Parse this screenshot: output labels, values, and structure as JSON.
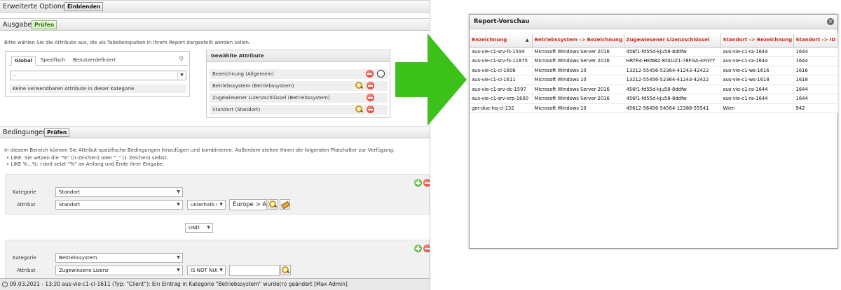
{
  "left": {
    "advanced": {
      "title": "Erweiterte Optionen",
      "toggle_label": "Einblenden"
    },
    "output": {
      "title": "Ausgabe",
      "check_label": "Prüfen",
      "description": "Bitte wählen Sie die Attribute aus, die als Tabellenspalten in Ihrem Report dargestellt werden sollen.",
      "tabs": [
        {
          "label": "Global"
        },
        {
          "label": "Spezifisch"
        },
        {
          "label": "Benutzerdefiniert"
        }
      ],
      "category_select_value": "-",
      "no_attributes_text": "Keine verwendbaren Attribute in dieser Kategorie",
      "selected_header": "Gewählte Attribute",
      "selected": [
        {
          "label": "Bezeichnung (Allgemein)"
        },
        {
          "label": "Betriebssystem (Betriebssystem)"
        },
        {
          "label": "Zugewiesener Lizenzschlüssel (Betriebssystem)"
        },
        {
          "label": "Standort (Standort)"
        }
      ]
    },
    "conditions": {
      "title": "Bedingungen",
      "check_label": "Prüfen",
      "description": "In diesem Bereich können Sie Attribut-spezifische Bedingungen hinzufügen und kombinieren. Außerdem stehen Ihnen die folgenden Platzhalter zur Verfügung:",
      "bullets": [
        "LIKE: Sie setzen die \"%\" (n-Zeichen) oder \"_\" (1 Zeichen) selbst.",
        "LIKE %...%: i-doit setzt \"%\" an Anfang und Ende ihrer Eingabe."
      ],
      "category_label": "Kategorie",
      "attribute_label": "Attribut",
      "block1": {
        "category": "Standort",
        "attribute": "Standort",
        "operator": "unterhalb v",
        "value": "Europe > Au"
      },
      "connector": "UND",
      "block2": {
        "category": "Betriebssystem",
        "attribute": "Zugewiesene Lizenz",
        "operator": "IS NOT NUL",
        "value": ""
      }
    },
    "status_bar": "09.03.2021 - 13:20 aus-vie-c1-cl-1611 (Typ: \"Client\"): Ein Eintrag in Kategorie \"Betriebssystem\" wurde(n) geändert [Max Admin]"
  },
  "preview": {
    "title": "Report-Vorschau",
    "columns": [
      "Bezeichnung",
      "Betriebssystem -> Bezeichnung",
      "Zugewiesener Lizenzschlüssel",
      "Standort -> Bezeichnung",
      "Standort -> ID"
    ],
    "rows": [
      [
        "aus-vie-c1-srv-fs-1594",
        "Microsoft Windows Server 2016",
        "456f1-fd55d-kju58-8ddfw",
        "aus-vie-c1-ra-1644",
        "1644"
      ],
      [
        "aus-vie-c1-srv-fs-11875",
        "Microsoft Windows Server 2016",
        "HRTR4-HKNBZ-8DLUZ1-78FGA-4FGYY",
        "aus-vie-c1-ra-1644",
        "1644"
      ],
      [
        "aus-vie-c1-cl-1606",
        "Microsoft Windows 10",
        "13212-55456-52364-41243-42422",
        "aus-vie-c1-ws-1616",
        "1616"
      ],
      [
        "aus-vie-c1-cl-1611",
        "Microsoft Windows 10",
        "13212-55456-52364-41243-42422",
        "aus-vie-c1-ws-1618",
        "1618"
      ],
      [
        "aus-vie-c1-srv-dc-1597",
        "Microsoft Windows Server 2016",
        "456f1-fd55d-kju58-8ddfw",
        "aus-vie-c1-ra-1644",
        "1644"
      ],
      [
        "aus-vie-c1-srv-erp-1600",
        "Microsoft Windows Server 2016",
        "456f1-fd55d-kju58-8ddfw",
        "aus-vie-c1-ra-1644",
        "1644"
      ],
      [
        "ger-due-hq-cl-132",
        "Microsoft Windows 10",
        "45612-56456-54564-12388-55541",
        "Wien",
        "942"
      ]
    ]
  },
  "colors": {
    "arrow": "#3cc01a",
    "header_text": "#d0291b",
    "check_green": "#2c6e12"
  }
}
